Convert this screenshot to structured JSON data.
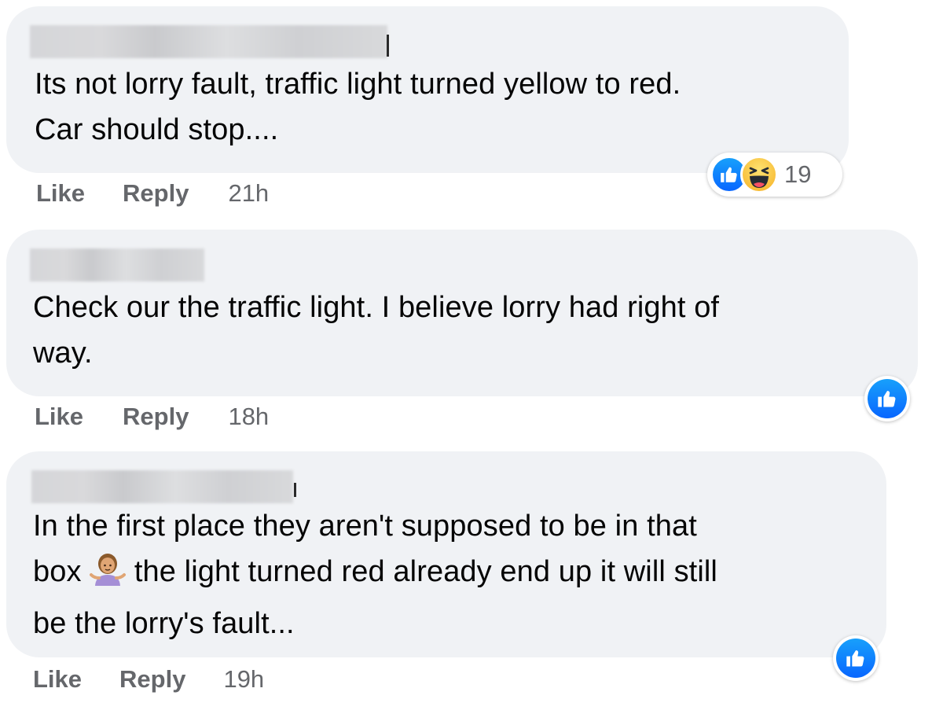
{
  "comments": [
    {
      "text": "Its not lorry fault, traffic light turned yellow to red.\nCar should stop....",
      "actions": {
        "like": "Like",
        "reply": "Reply",
        "time": "21h"
      },
      "reactions": {
        "icons": [
          "like-icon",
          "haha-icon"
        ],
        "count": "19"
      }
    },
    {
      "text": "Check our the traffic light. I believe lorry had right of\nway.",
      "actions": {
        "like": "Like",
        "reply": "Reply",
        "time": "18h"
      },
      "reactions": {
        "icons": [
          "like-icon"
        ]
      }
    },
    {
      "text_before_emoji": "In the first place they aren't supposed to be in that\nbox ",
      "emoji": "woman-shrugging-icon",
      "text_after_emoji": " the light turned red already end up it will still\nbe the lorry's fault...",
      "actions": {
        "like": "Like",
        "reply": "Reply",
        "time": "19h"
      },
      "reactions": {
        "icons": [
          "like-icon"
        ]
      }
    }
  ],
  "colors": {
    "bubble": "#f0f2f5",
    "text": "#050505",
    "secondary_text": "#65676b",
    "like_blue": "#0866ff",
    "haha_yellow": "#f7b125"
  }
}
